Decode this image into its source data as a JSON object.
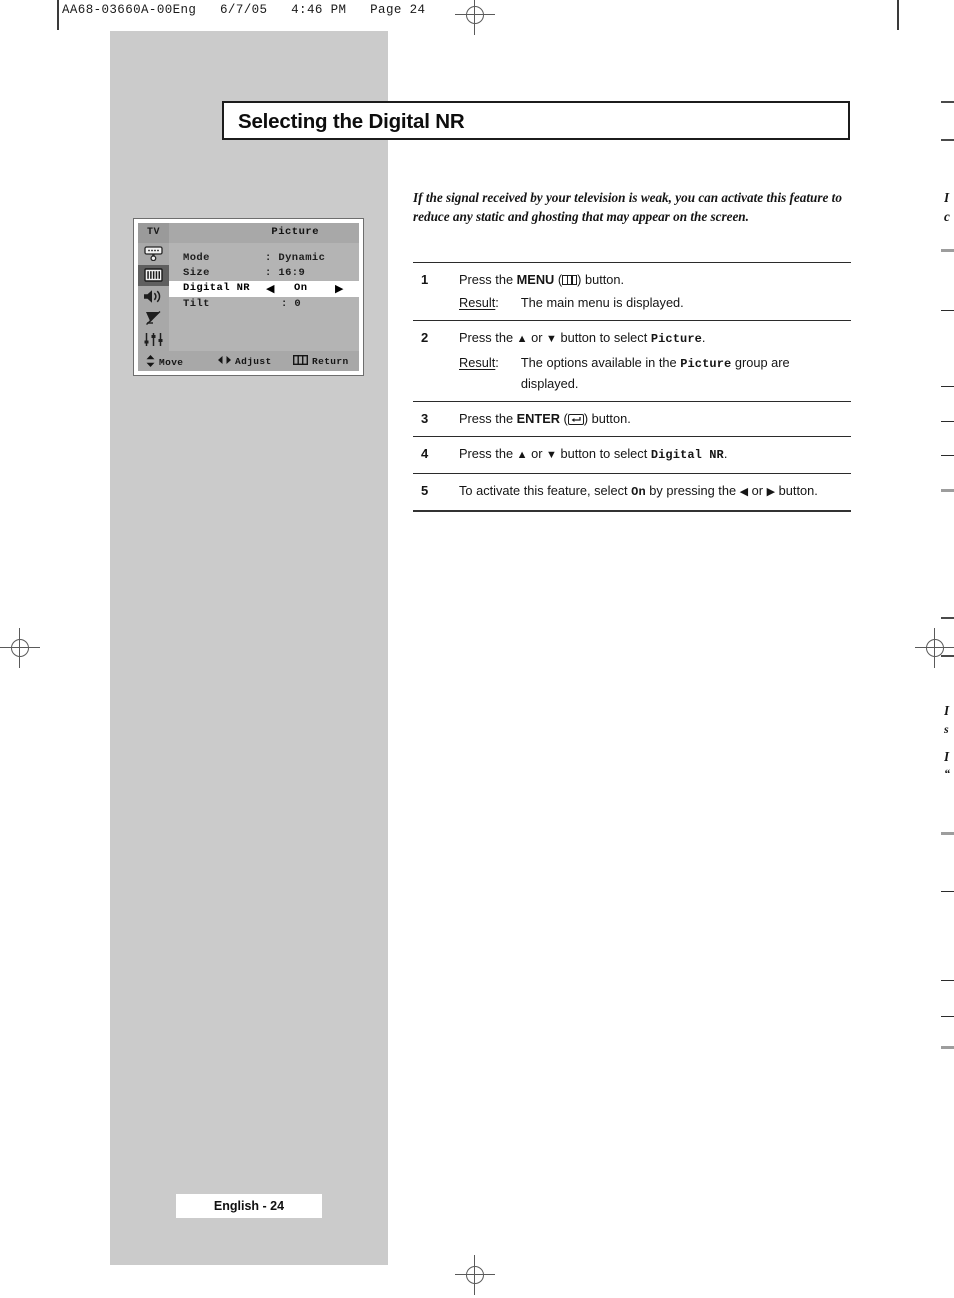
{
  "prepress": {
    "header": "AA68-03660A-00Eng   6/7/05   4:46 PM   Page 24"
  },
  "page": {
    "title": "Selecting the Digital NR",
    "footer_label": "English - 24"
  },
  "intro": {
    "text": "If the signal received by your television is weak, you can activate this feature to reduce any static and ghosting that may appear on the screen."
  },
  "osd": {
    "tv_tag": "TV",
    "heading": "Picture",
    "icons": [
      {
        "name": "antenna-icon",
        "selected": false
      },
      {
        "name": "picture-icon",
        "selected": true
      },
      {
        "name": "speaker-icon",
        "selected": false
      },
      {
        "name": "satellite-dish-icon",
        "selected": false
      },
      {
        "name": "setup-sliders-icon",
        "selected": false
      }
    ],
    "rows": [
      {
        "label": "Mode",
        "value": ": Dynamic",
        "highlighted": false
      },
      {
        "label": "Size",
        "value": ": 16:9",
        "highlighted": false
      },
      {
        "label": "Digital NR",
        "value": "On",
        "highlighted": true,
        "arrow_left": "◀",
        "arrow_right": "▶"
      },
      {
        "label": "Tilt",
        "value": ": 0",
        "highlighted": false
      }
    ],
    "bottom_bar": [
      {
        "icon": "updown-arrows-icon",
        "label": "Move"
      },
      {
        "icon": "leftright-arrows-icon",
        "label": "Adjust"
      },
      {
        "icon": "menu-bars-icon",
        "label": "Return"
      }
    ]
  },
  "steps": [
    {
      "number": "1",
      "pre": "Press the ",
      "key": "MENU",
      "icon": "menu-button-icon",
      "post": ") button.",
      "paren_open": " (",
      "result_word": "Result",
      "result_colon": ":",
      "result_text": "The main menu is displayed."
    },
    {
      "number": "2",
      "pre": "Press the ",
      "arrow_up": "▲",
      "mid": " or ",
      "arrow_down": "▼",
      "post": " button to select ",
      "mono_term": "Picture",
      "tail": ".",
      "result_word": "Result",
      "result_colon": ":",
      "result_text_a": "The options available in the ",
      "result_mono": "Picture",
      "result_text_b": " group are displayed."
    },
    {
      "number": "3",
      "pre": "Press the ",
      "key": "ENTER",
      "icon": "enter-button-icon",
      "paren_open": " (",
      "post": ") button."
    },
    {
      "number": "4",
      "pre": "Press the ",
      "arrow_up": "▲",
      "mid": " or ",
      "arrow_down": "▼",
      "post": " button to select ",
      "mono_term": "Digital NR",
      "tail": "."
    },
    {
      "number": "5",
      "pre": "To activate this feature, select ",
      "mono_term": "On",
      "mid": " by pressing the ",
      "arrow_left": "◀",
      "mid2": " or ",
      "arrow_right": "▶",
      "tail": " button."
    }
  ],
  "edge_fragments": [
    {
      "name": "edge-text-1",
      "text": "I"
    },
    {
      "name": "edge-text-2",
      "text": "c"
    },
    {
      "name": "edge-text-3",
      "text": "I"
    },
    {
      "name": "edge-text-4",
      "text": "s"
    },
    {
      "name": "edge-text-5",
      "text": "I"
    },
    {
      "name": "edge-text-6",
      "text": "“"
    }
  ],
  "colors": {
    "panel_grey": "#cbcbcb",
    "osd_body": "#b4b4b4",
    "osd_bar": "#a8a8a8",
    "osd_selected": "#5f5f5f",
    "ink": "#141414"
  }
}
